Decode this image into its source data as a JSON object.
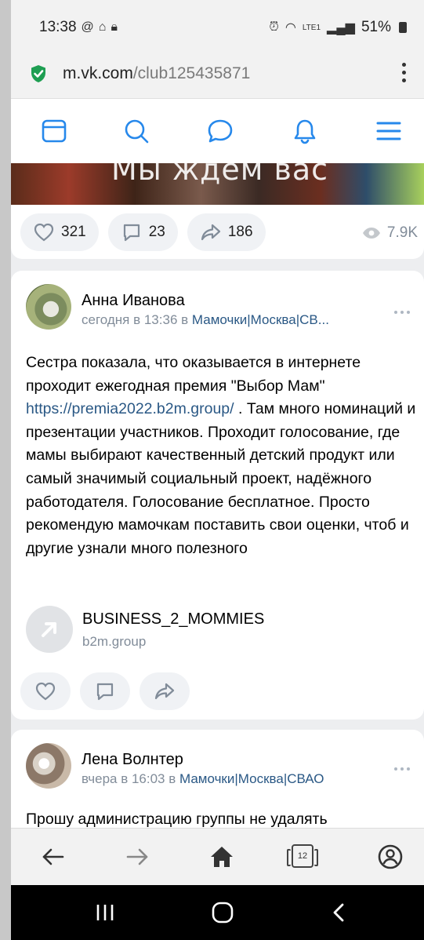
{
  "status_bar": {
    "time": "13:38",
    "battery": "51%",
    "network": "LTE1"
  },
  "browser": {
    "domain": "m.vk.com",
    "path": "/club125435871"
  },
  "vk_nav": {
    "icons": [
      "newsfeed-icon",
      "search-icon",
      "messages-icon",
      "notifications-icon",
      "menu-icon"
    ],
    "accent_color": "#2688eb"
  },
  "post1": {
    "banner_text": "Мы ждем вас",
    "likes": "321",
    "comments": "23",
    "shares": "186",
    "views": "7.9K"
  },
  "post2": {
    "author": "Анна Иванова",
    "time": "сегодня в 13:36 в",
    "group": "Мамочки|Москва|СВ...",
    "text_before_link": "Сестра показала, что оказывается в интернете проходит ежегодная премия \"Выбор Мам\"",
    "link": "https://premia2022.b2m.group/",
    "text_after_link": " . Там много номинаций и презентации участников. Проходит голосование, где мамы выбирают качественный детский продукт или самый значимый социальный проект, надёжного работодателя. Голосование бесплатное. Просто рекомендую мамочкам поставить свои оценки, чтоб и другие узнали много полезного",
    "link_card_title": "BUSINESS_2_MOMMIES",
    "link_card_domain": "b2m.group"
  },
  "post3": {
    "author": "Лена Волнтер",
    "time": "вчера в 16:03 в",
    "group": "Мамочки|Москва|СВАО",
    "text": "Прошу администрацию группы не удалять"
  },
  "browser_toolbar": {
    "tab_count": "12"
  }
}
